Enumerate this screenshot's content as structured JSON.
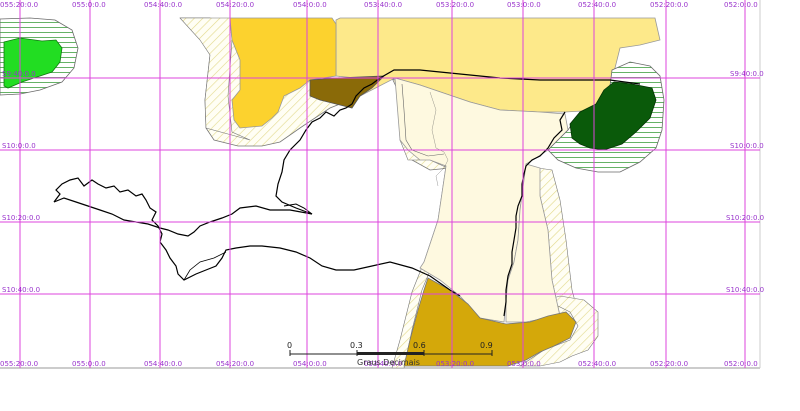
{
  "map": {
    "top_labels": [
      "055:20:0.0",
      "055:0:0.0",
      "054:40:0.0",
      "054:20:0.0",
      "054:0:0.0",
      "053:40:0.0",
      "053:20:0.0",
      "053:0:0.0",
      "052:40:0.0",
      "052:20:0.0",
      "052:0:0.0"
    ],
    "bottom_labels": [
      "055:20:0.0",
      "055:0:0.0",
      "054:40:0.0",
      "054:20:0.0",
      "054:0:0.0",
      "053:40:0.0",
      "053:20:0.0",
      "053:0:0.0",
      "052:40:0.0",
      "052:20:0.0",
      "052:0:0.0"
    ],
    "left_labels": [
      "S9:40:0.0",
      "S10:0:0.0",
      "S10:20:0.0",
      "S10:40:0.0"
    ],
    "right_labels": [
      "S9:40:0.0",
      "S10:0:0.0",
      "S10:20:0.0",
      "S10:40:0.0"
    ],
    "scalebar": {
      "ticks": [
        "0",
        "0.3",
        "0.6",
        "0.9"
      ],
      "unit": "Graus Decimais"
    },
    "colors": {
      "grid": "#dd44dd",
      "label": "#9933cc",
      "gold": "#fcd22e",
      "light_yellow": "#fde98a",
      "pale_yellow": "#fef9e0",
      "brown": "#8a6a08",
      "mustard": "#d4a80a",
      "dark_green": "#0a5a0a",
      "bright_green": "#22dd22",
      "hatch_green": "#55aa55",
      "hatch_yellow": "#e0d890",
      "boundary": "#000000"
    }
  }
}
